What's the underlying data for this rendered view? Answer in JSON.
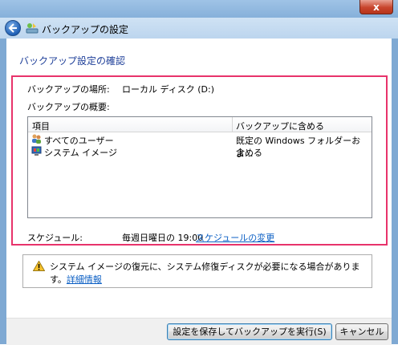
{
  "window": {
    "close_label": "x",
    "title": "バックアップの設定"
  },
  "page": {
    "heading": "バックアップ設定の確認"
  },
  "summary": {
    "location_label": "バックアップの場所:",
    "location_value": "ローカル ディスク (D:)",
    "overview_label": "バックアップの概要:"
  },
  "table": {
    "columns": [
      "項目",
      "バックアップに含める"
    ],
    "rows": [
      {
        "icon": "users-icon",
        "item": "すべてのユーザー",
        "value": "既定の Windows フォルダーおよ..."
      },
      {
        "icon": "system-image-icon",
        "item": "システム イメージ",
        "value": "含める"
      }
    ]
  },
  "schedule": {
    "label": "スケジュール:",
    "value": "毎週日曜日の 19:00",
    "change_link": "スケジュールの変更"
  },
  "info": {
    "icon": "warning-icon",
    "text": "システム イメージの復元に、システム修復ディスクが必要になる場合があります。",
    "link": "詳細情報"
  },
  "buttons": {
    "save_run": "設定を保存してバックアップを実行(S)",
    "cancel": "キャンセル"
  },
  "colors": {
    "highlight": "#e8336b",
    "heading": "#1e3f99",
    "link": "#0b5fc4"
  }
}
